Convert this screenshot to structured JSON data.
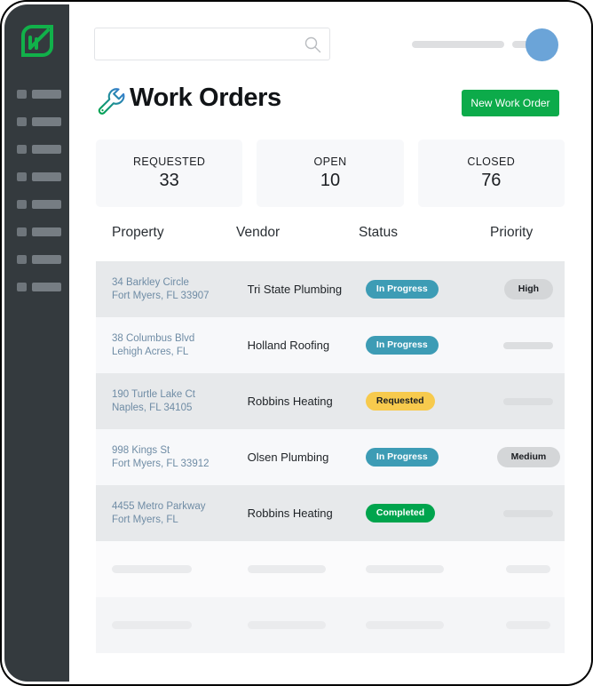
{
  "brand": {
    "logo_icon": "leaf-logo-icon",
    "logo_color": "#11b14a",
    "sidebar_color": "#343a3e"
  },
  "sidebar": {
    "placeholder_item_count": 8
  },
  "topbar": {
    "search_placeholder": "",
    "search_value": "",
    "search_icon": "search-icon",
    "nav_placeholder_count": 2,
    "avatar_color": "#6ba4d8"
  },
  "header": {
    "title": "Work Orders",
    "title_icon": "wrench-icon",
    "new_work_order_label": "New Work Order",
    "new_work_order_color": "#0cab4a"
  },
  "stats": [
    {
      "label": "REQUESTED",
      "value": "33"
    },
    {
      "label": "OPEN",
      "value": "10"
    },
    {
      "label": "CLOSED",
      "value": "76"
    }
  ],
  "table": {
    "columns": [
      "Property",
      "Vendor",
      "Status",
      "Priority"
    ],
    "rows": [
      {
        "property_line1": "34 Barkley Circle",
        "property_line2": "Fort Myers, FL 33907",
        "vendor": "Tri State Plumbing",
        "status": "In Progress",
        "status_type": "inprogress",
        "priority": "High",
        "priority_placeholder": false
      },
      {
        "property_line1": "38 Columbus Blvd",
        "property_line2": "Lehigh Acres, FL",
        "vendor": "Holland Roofing",
        "status": "In Progress",
        "status_type": "inprogress",
        "priority": "",
        "priority_placeholder": true
      },
      {
        "property_line1": "190 Turtle Lake Ct",
        "property_line2": "Naples, FL 34105",
        "vendor": "Robbins Heating",
        "status": "Requested",
        "status_type": "requested",
        "priority": "",
        "priority_placeholder": true
      },
      {
        "property_line1": "998 Kings St",
        "property_line2": "Fort Myers, FL 33912",
        "vendor": "Olsen Plumbing",
        "status": "In Progress",
        "status_type": "inprogress",
        "priority": "Medium",
        "priority_placeholder": false
      },
      {
        "property_line1": "4455 Metro Parkway",
        "property_line2": "Fort Myers, FL",
        "vendor": "Robbins Heating",
        "status": "Completed",
        "status_type": "completed",
        "priority": "",
        "priority_placeholder": true
      }
    ],
    "skeleton_row_count": 2,
    "status_colors": {
      "inprogress": "#3d9cb5",
      "requested": "#f7ca4d",
      "completed": "#00a44d",
      "priority": "#d4d6d8"
    }
  }
}
